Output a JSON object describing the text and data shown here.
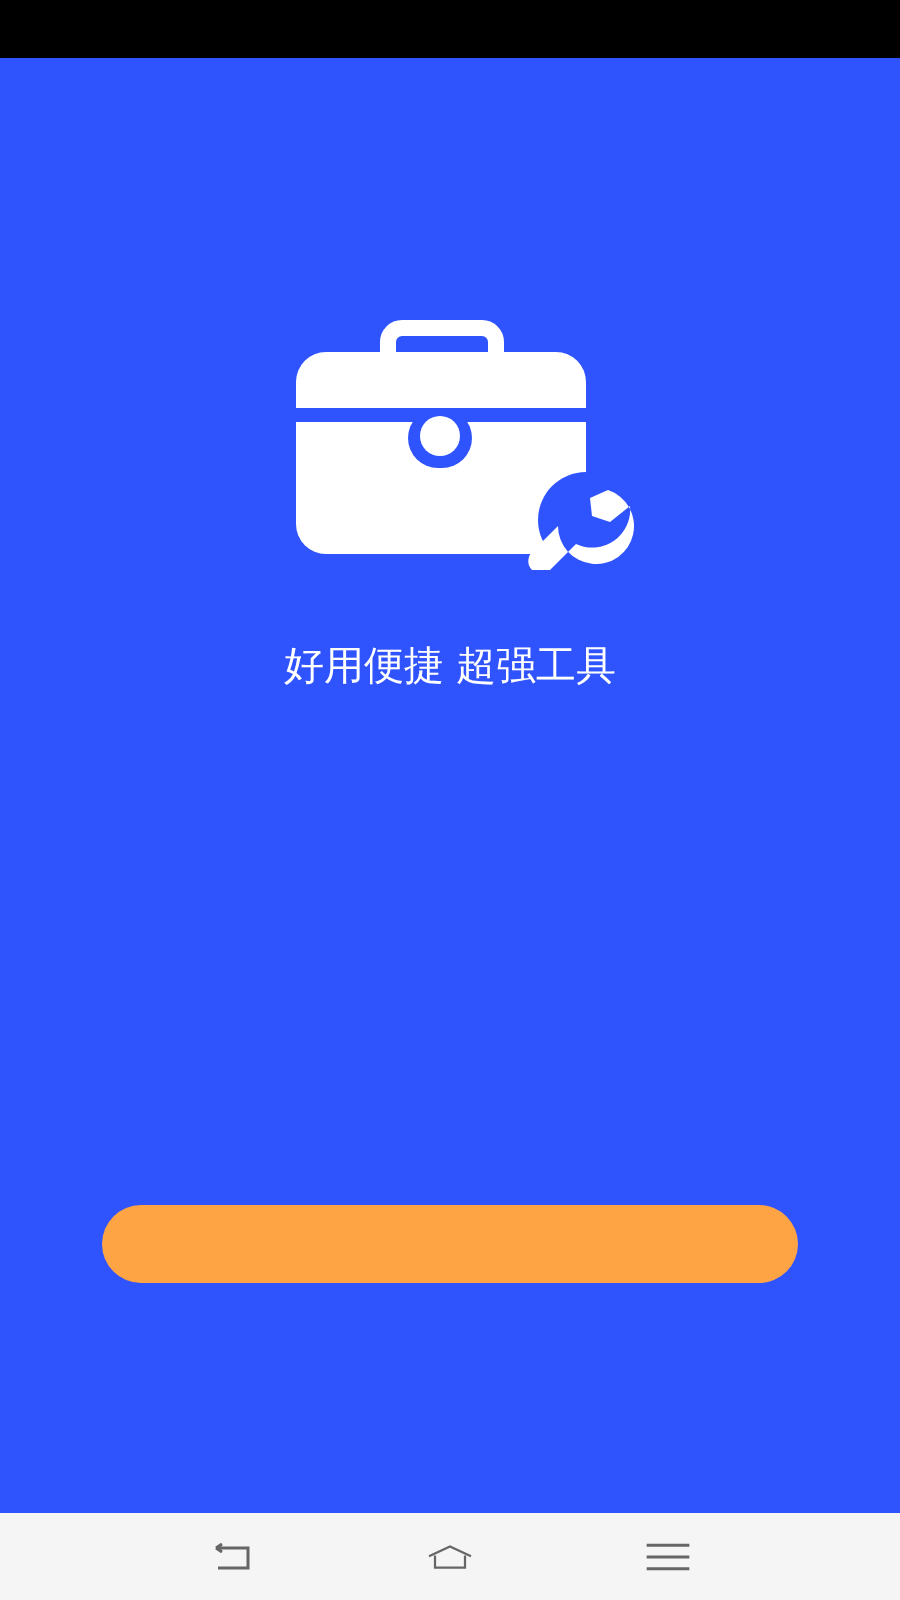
{
  "splash": {
    "tagline": "好用便捷 超强工具"
  }
}
